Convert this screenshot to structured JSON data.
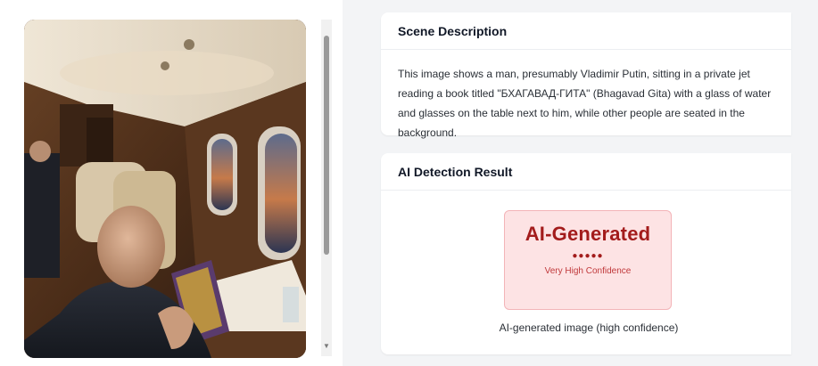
{
  "scene_card": {
    "title": "Scene Description",
    "description": "This image shows a man, presumably Vladimir Putin, sitting in a private jet reading a book titled \"БХАГАВАД-ГИТА\" (Bhagavad Gita) with a glass of water and glasses on the table next to him, while other people are seated in the background."
  },
  "ai_card": {
    "title": "AI Detection Result",
    "result_label": "AI-Generated",
    "confidence_dots": "●●●●●",
    "confidence_label": "Very High Confidence",
    "caption": "AI-generated image (high confidence)"
  },
  "scrollbar": {
    "down_arrow": "▼"
  },
  "colors": {
    "page_bg": "#f3f4f6",
    "card_bg": "#ffffff",
    "result_bg": "#fde3e4",
    "result_border": "#f3b4b8",
    "result_text": "#a31c1c"
  },
  "icons": {
    "scroll_down": "chevron-down-icon"
  }
}
